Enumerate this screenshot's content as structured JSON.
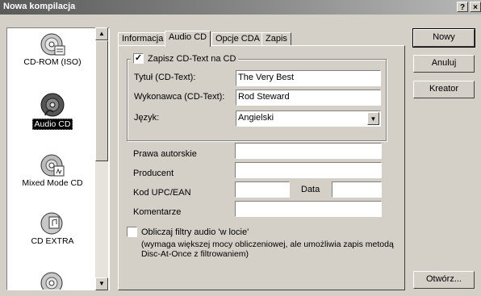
{
  "window": {
    "title": "Nowa kompilacja",
    "help_btn": "?",
    "close_btn": "×"
  },
  "compilation_types": [
    {
      "label": "CD-ROM (ISO)",
      "icon": "cd-rom-disc-icon",
      "selected": false
    },
    {
      "label": "Audio CD",
      "icon": "audio-cd-disc-icon",
      "selected": true
    },
    {
      "label": "Mixed Mode CD",
      "icon": "mixed-mode-disc-icon",
      "selected": false
    },
    {
      "label": "CD EXTRA",
      "icon": "cd-extra-disc-icon",
      "selected": false
    }
  ],
  "tabs": [
    {
      "label": "Informacja",
      "active": false
    },
    {
      "label": "Audio CD",
      "active": true
    },
    {
      "label": "Opcje CDA",
      "active": false
    },
    {
      "label": "Zapis",
      "active": false
    }
  ],
  "cd_text": {
    "checkbox_label": "Zapisz CD-Text na CD",
    "checked": true,
    "title_label": "Tytuł (CD-Text):",
    "title_value": "The Very Best",
    "artist_label": "Wykonawca (CD-Text):",
    "artist_value": "Rod Steward",
    "language_label": "Język:",
    "language_value": "Angielski"
  },
  "meta": {
    "copyright_label": "Prawa autorskie",
    "copyright_value": "",
    "producer_label": "Producent",
    "producer_value": "",
    "upc_label": "Kod UPC/EAN",
    "upc_value": "",
    "date_label": "Data",
    "date_value": "",
    "comments_label": "Komentarze",
    "comments_value": ""
  },
  "filters": {
    "checkbox_label": "Obliczaj filtry audio 'w locie'",
    "checked": false,
    "note_line1": "(wymaga większej mocy obliczeniowej, ale umożliwia zapis metodą",
    "note_line2": "Disc-At-Once z filtrowaniem)"
  },
  "buttons": {
    "new": "Nowy",
    "cancel": "Anuluj",
    "wizard": "Kreator",
    "open": "Otwórz..."
  },
  "scroll": {
    "up": "▲",
    "down": "▼"
  },
  "dropdown_arrow": "▼",
  "check_mark": "✓"
}
